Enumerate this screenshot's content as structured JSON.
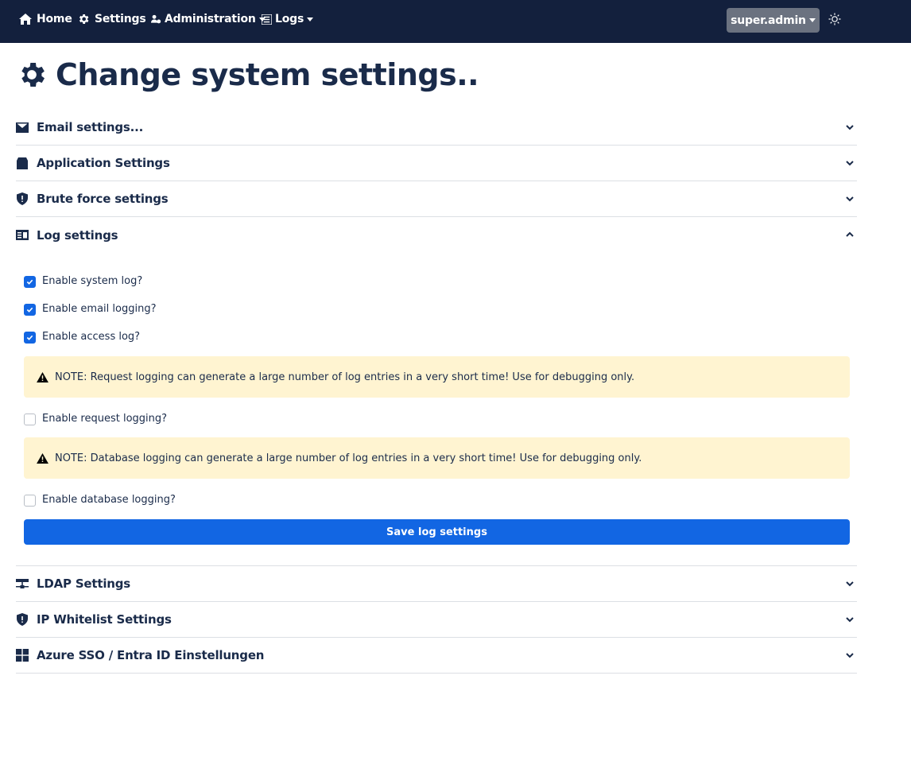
{
  "navbar": {
    "home_label": "Home",
    "settings_label": "Settings",
    "administration_label": "Administration",
    "logs_label": "Logs",
    "user_label": "super.admin"
  },
  "page": {
    "title": "Change system settings.."
  },
  "sections": {
    "email": "Email settings...",
    "application": "Application Settings",
    "brute_force": "Brute force settings",
    "log": "Log settings",
    "ldap": "LDAP Settings",
    "ip_whitelist": "IP Whitelist Settings",
    "azure": "Azure SSO / Entra ID Einstellungen"
  },
  "log_settings": {
    "system_log": {
      "label": "Enable system log?",
      "checked": true
    },
    "email_logging": {
      "label": "Enable email logging?",
      "checked": true
    },
    "access_log": {
      "label": "Enable access log?",
      "checked": true
    },
    "request_note": "NOTE: Request logging can generate a large number of log entries in a very short time! Use for debugging only.",
    "request_logging": {
      "label": "Enable request logging?",
      "checked": false
    },
    "database_note": "NOTE: Database logging can generate a large number of log entries in a very short time! Use for debugging only.",
    "database_logging": {
      "label": "Enable database logging?",
      "checked": false
    },
    "save_label": "Save log settings"
  },
  "colors": {
    "navbar_bg": "#13203d",
    "primary": "#1266e3",
    "warning_bg": "#fff4d1",
    "text": "#1a2b4a"
  },
  "icons": {
    "home": "home-icon",
    "settings": "gear-icon",
    "administration": "users-cog-icon",
    "logs": "list-icon",
    "theme": "sun-icon"
  }
}
